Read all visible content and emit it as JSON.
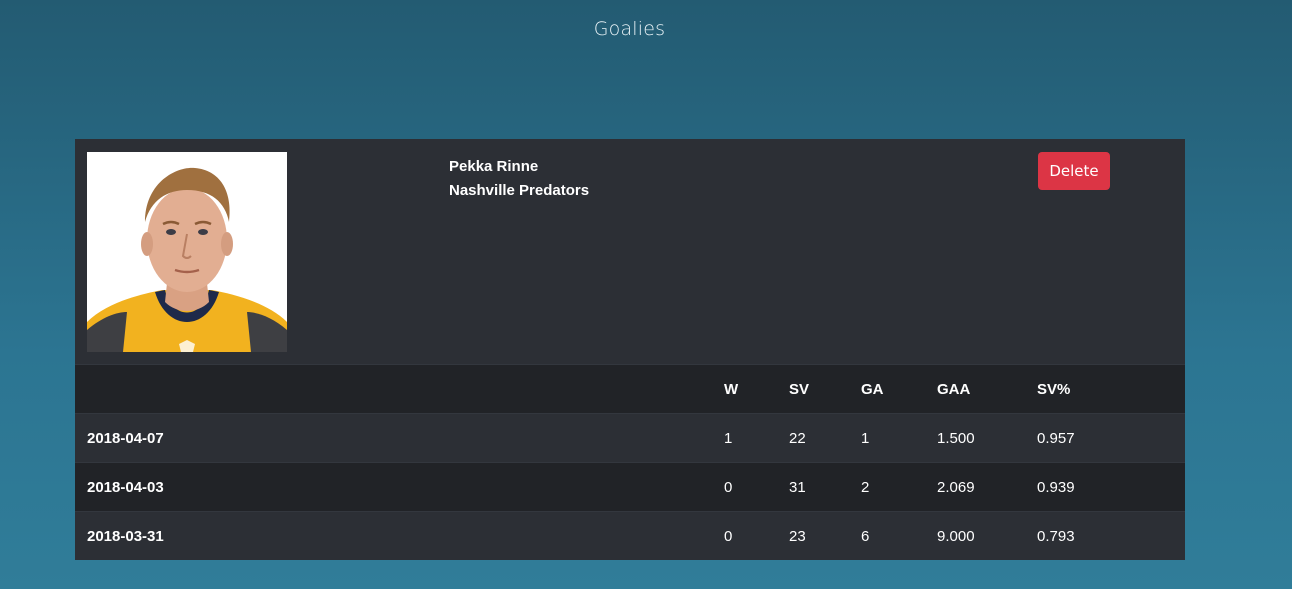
{
  "page": {
    "title": "Goalies"
  },
  "player": {
    "name": "Pekka Rinne",
    "team": "Nashville Predators",
    "photo_icon": "player-headshot",
    "delete_label": "Delete"
  },
  "colors": {
    "background_top": "#235b72",
    "background_bottom": "#307d99",
    "card": "#2c2f35",
    "row_dark": "#212327",
    "delete_button": "#dc3545"
  },
  "stats": {
    "headers": [
      "",
      "W",
      "SV",
      "GA",
      "GAA",
      "SV%"
    ],
    "rows": [
      {
        "date": "2018-04-07",
        "w": "1",
        "sv": "22",
        "ga": "1",
        "gaa": "1.500",
        "svp": "0.957"
      },
      {
        "date": "2018-04-03",
        "w": "0",
        "sv": "31",
        "ga": "2",
        "gaa": "2.069",
        "svp": "0.939"
      },
      {
        "date": "2018-03-31",
        "w": "0",
        "sv": "23",
        "ga": "6",
        "gaa": "9.000",
        "svp": "0.793"
      }
    ]
  }
}
